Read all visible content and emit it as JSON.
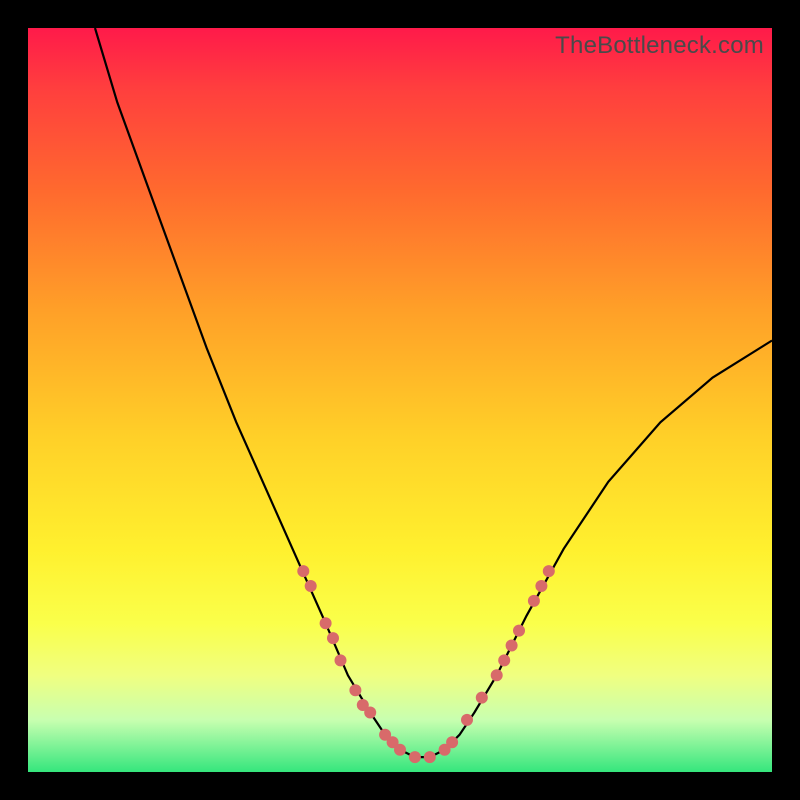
{
  "watermark": "TheBottleneck.com",
  "chart_data": {
    "type": "line",
    "title": "",
    "xlabel": "",
    "ylabel": "",
    "xlim": [
      0,
      100
    ],
    "ylim": [
      0,
      100
    ],
    "grid": false,
    "legend": false,
    "background_gradient": {
      "direction": "vertical",
      "stops": [
        {
          "pos": 0,
          "color": "#ff1a4a"
        },
        {
          "pos": 8,
          "color": "#ff3e3e"
        },
        {
          "pos": 22,
          "color": "#ff6a2e"
        },
        {
          "pos": 38,
          "color": "#ffa028"
        },
        {
          "pos": 55,
          "color": "#ffd028"
        },
        {
          "pos": 70,
          "color": "#fff02e"
        },
        {
          "pos": 80,
          "color": "#faff4a"
        },
        {
          "pos": 87,
          "color": "#f0ff80"
        },
        {
          "pos": 93,
          "color": "#c8ffb0"
        },
        {
          "pos": 100,
          "color": "#35e67d"
        }
      ]
    },
    "series": [
      {
        "name": "bottleneck-curve",
        "color": "#000000",
        "x": [
          9,
          12,
          16,
          20,
          24,
          28,
          32,
          36,
          40,
          43,
          46,
          48,
          50,
          52,
          54,
          56,
          58,
          60,
          63,
          67,
          72,
          78,
          85,
          92,
          100
        ],
        "y": [
          100,
          90,
          79,
          68,
          57,
          47,
          38,
          29,
          20,
          13,
          8,
          5,
          3,
          2,
          2,
          3,
          5,
          8,
          13,
          21,
          30,
          39,
          47,
          53,
          58
        ]
      }
    ],
    "markers": {
      "name": "highlighted-points",
      "shape": "circle",
      "color": "#d86a6a",
      "radius_px": 6,
      "points": [
        {
          "x": 37,
          "y": 27
        },
        {
          "x": 38,
          "y": 25
        },
        {
          "x": 40,
          "y": 20
        },
        {
          "x": 41,
          "y": 18
        },
        {
          "x": 42,
          "y": 15
        },
        {
          "x": 44,
          "y": 11
        },
        {
          "x": 45,
          "y": 9
        },
        {
          "x": 46,
          "y": 8
        },
        {
          "x": 48,
          "y": 5
        },
        {
          "x": 49,
          "y": 4
        },
        {
          "x": 50,
          "y": 3
        },
        {
          "x": 52,
          "y": 2
        },
        {
          "x": 54,
          "y": 2
        },
        {
          "x": 56,
          "y": 3
        },
        {
          "x": 57,
          "y": 4
        },
        {
          "x": 59,
          "y": 7
        },
        {
          "x": 61,
          "y": 10
        },
        {
          "x": 63,
          "y": 13
        },
        {
          "x": 64,
          "y": 15
        },
        {
          "x": 65,
          "y": 17
        },
        {
          "x": 66,
          "y": 19
        },
        {
          "x": 68,
          "y": 23
        },
        {
          "x": 69,
          "y": 25
        },
        {
          "x": 70,
          "y": 27
        }
      ]
    }
  }
}
